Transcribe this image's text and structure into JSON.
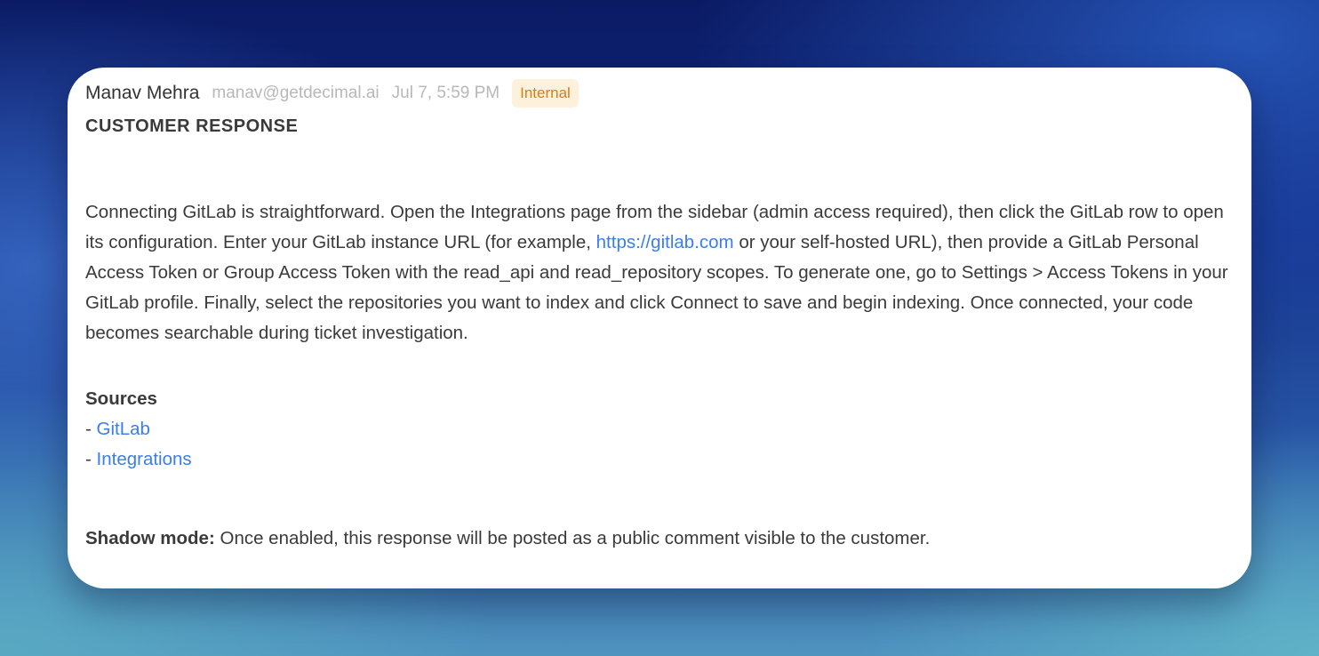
{
  "message": {
    "author_name": "Manav Mehra",
    "author_email": "manav@getdecimal.ai",
    "timestamp": "Jul 7, 5:59 PM",
    "badge": "Internal",
    "section_title": "CUSTOMER RESPONSE",
    "body": {
      "part1": "Connecting GitLab is straightforward. Open the Integrations page from the sidebar (admin access required), then click the GitLab row to open its configuration. Enter your GitLab instance URL (for example, ",
      "link_text": "https://gitlab.com",
      "part2": " or your self-hosted URL), then provide a GitLab Personal Access Token or Group Access Token with the read_api and read_repository scopes. To generate one, go to Settings > Access Tokens in your GitLab profile. Finally, select the repositories you want to index and click Connect to save and begin indexing. Once connected, your code becomes searchable during ticket investigation."
    },
    "sources": {
      "heading": "Sources",
      "prefix": "- ",
      "items": [
        {
          "label": "GitLab"
        },
        {
          "label": "Integrations"
        }
      ]
    },
    "shadow_mode": {
      "label": "Shadow mode:",
      "text": " Once enabled, this response will be posted as a public comment visible to the customer."
    }
  },
  "colors": {
    "link": "#3b7ee8",
    "badge_text": "#d0801a",
    "badge_bg": "#fdf1dc"
  }
}
